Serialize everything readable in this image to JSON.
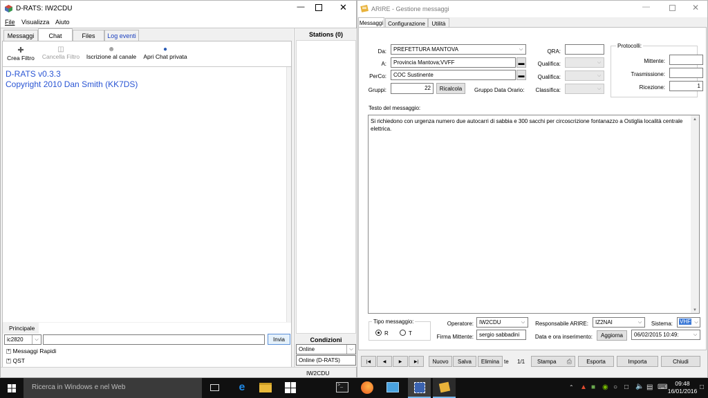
{
  "left_window": {
    "title": "D-RATS: IW2CDU",
    "menu": [
      "File",
      "Visualizza",
      "Aiuto"
    ],
    "tabs": [
      "Messaggi",
      "Chat",
      "Files",
      "Log eventi"
    ],
    "toolbar": [
      "Crea Filtro",
      "Cancella Filtro",
      "Iscrizione al canale",
      "Apri Chat privata"
    ],
    "chat_lines": [
      "D-RATS v0.3.3",
      "Copyright 2010 Dan Smith (KK7DS)"
    ],
    "channel_label": "Principale",
    "call_select": "ic2820",
    "send_label": "Invia",
    "tree": [
      "Messaggi Rapidi",
      "QST"
    ],
    "stations_title": "Stations (0)",
    "conditions_title": "Condizioni",
    "status_select": "Online",
    "status_value": "Online (D-RATS)",
    "statusbar_call": "IW2CDU"
  },
  "right_window": {
    "title": "ARIRE - Gestione messaggi",
    "tabs": [
      "Messaggi",
      "Configurazione",
      "Utilità"
    ],
    "da_label": "Da:",
    "da_value": "PREFETTURA MANTOVA",
    "a_label": "A:",
    "a_value": "Provincia Mantova;VVFF",
    "perco_label": "PerCo:",
    "perco_value": "COC Sustinente",
    "gruppi_label": "Gruppi:",
    "gruppi_value": "22",
    "ricalcola": "Ricalcola",
    "gruppo_data": "Gruppo Data Orario:",
    "qra_label": "QRA:",
    "qualifica1": "Qualifica:",
    "qualifica2": "Qualifica:",
    "classifica": "Classifica:",
    "protocolli": "Protocolli:",
    "mittente_label": "Mittente:",
    "trasmissione_label": "Trasmissione:",
    "ricezione_label": "Ricezione:",
    "ricezione_value": "1",
    "testo_label": "Testo del messaggio:",
    "testo": "Si richiedono con urgenza numero due autocarri di sabbia e 300 sacchi per circoscrizione fontanazzo a Ostiglia località centrale elettrica.",
    "tipo_label": "Tipo messaggio:",
    "radio_r": "R",
    "radio_t": "T",
    "operatore_label": "Operatore:",
    "operatore_value": "IW2CDU",
    "firma_label": "Firma Mittente:",
    "firma_value": "sergio sabbadini",
    "responsabile_label": "Responsabile ARIRE:",
    "responsabile_value": "IZ2NAI",
    "data_label": "Data e ora inserimento:",
    "aggiorna": "Aggiorna",
    "data_value": "06/02/2015 10:49:",
    "sistema_label": "Sistema:",
    "sistema_value": "VHF",
    "nav": [
      "|◀",
      "◀",
      "▶",
      "▶|"
    ],
    "bottom_buttons": [
      "Nuovo",
      "Salva",
      "Elimina"
    ],
    "te_label": "te",
    "page": "1/1",
    "stampa": "Stampa",
    "esporta": "Esporta",
    "importa": "Importa",
    "chiudi": "Chiudi"
  },
  "taskbar": {
    "search_placeholder": "Ricerca in Windows e nel Web",
    "time": "09:48",
    "date": "16/01/2016"
  }
}
